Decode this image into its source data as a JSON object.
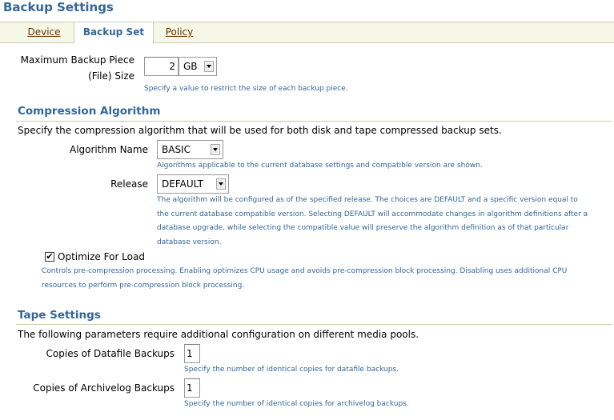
{
  "page": {
    "title": "Backup Settings"
  },
  "tabs": [
    {
      "label": "Device"
    },
    {
      "label": "Backup Set"
    },
    {
      "label": "Policy"
    }
  ],
  "backup_piece": {
    "label_line1": "Maximum Backup Piece",
    "label_line2": "(File) Size",
    "value": "2",
    "unit": "GB",
    "hint": "Specify a value to restrict the size of each backup piece."
  },
  "compression": {
    "heading": "Compression Algorithm",
    "description": "Specify the compression algorithm that will be used for both disk and tape compressed backup sets.",
    "algorithm_label": "Algorithm Name",
    "algorithm_value": "BASIC",
    "algorithm_hint": "Algorithms applicable to the current database settings and compatible version are shown.",
    "release_label": "Release",
    "release_value": "DEFAULT",
    "release_hint_lines": [
      "The algorithm will be configured as of the specified release. The choices are DEFAULT and a specific version equal to",
      "the current database compatible version. Selecting DEFAULT will accommodate changes in algorithm definitions after a",
      "database upgrade, while selecting the compatible value will preserve the algorithm definition as of that particular",
      "database version."
    ],
    "optimize_label": "Optimize For Load",
    "optimize_checked": true,
    "optimize_hint_lines": [
      "Controls pre-compression processing. Enabling optimizes CPU usage and avoids pre-compression block processing. Disabling uses additional CPU",
      "resources to perform pre-compression block processing."
    ]
  },
  "tape": {
    "heading": "Tape Settings",
    "description": "The following parameters require additional configuration on different media pools.",
    "datafile_label": "Copies of Datafile Backups",
    "datafile_value": "1",
    "datafile_hint": "Specify the number of identical copies for datafile backups.",
    "archivelog_label": "Copies of Archivelog Backups",
    "archivelog_value": "1",
    "archivelog_hint": "Specify the number of identical copies for archivelog backups."
  }
}
